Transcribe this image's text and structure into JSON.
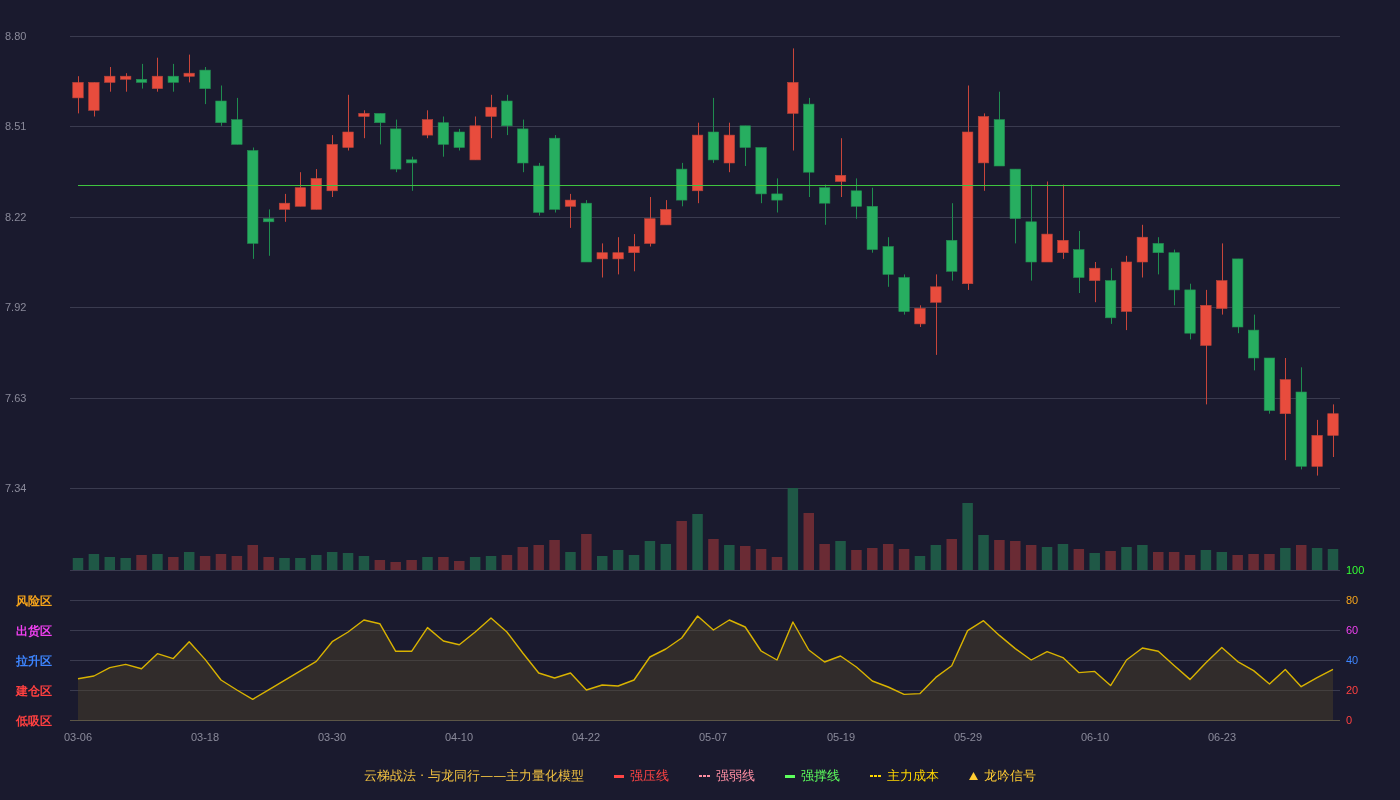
{
  "price_chart": {
    "chart_data": {
      "type": "candlestick",
      "grid": true,
      "categories": [
        null,
        null,
        null,
        null,
        null,
        null,
        null,
        null,
        null,
        null,
        null,
        null,
        null,
        null,
        null,
        null,
        null,
        null,
        null,
        null,
        null,
        null,
        null,
        null,
        null,
        null,
        null,
        null,
        null,
        null,
        null,
        null,
        null,
        null,
        null,
        null,
        null,
        null,
        null,
        null,
        null,
        null,
        null,
        null,
        null,
        null,
        null,
        null,
        null,
        null,
        null,
        null,
        null,
        null,
        null,
        null,
        null,
        null,
        null,
        null,
        null,
        null,
        null,
        null,
        null,
        null,
        null,
        null,
        null,
        null,
        null,
        null,
        null,
        null,
        null,
        null,
        null,
        null,
        null,
        null
      ],
      "ohlc": [
        [
          8.6,
          8.67,
          8.55,
          8.65
        ],
        [
          8.56,
          8.65,
          8.54,
          8.65
        ],
        [
          8.65,
          8.7,
          8.62,
          8.67
        ],
        [
          8.66,
          8.68,
          8.62,
          8.67
        ],
        [
          8.66,
          8.71,
          8.63,
          8.65
        ],
        [
          8.63,
          8.73,
          8.62,
          8.67
        ],
        [
          8.67,
          8.71,
          8.62,
          8.65
        ],
        [
          8.67,
          8.74,
          8.65,
          8.68
        ],
        [
          8.69,
          8.7,
          8.58,
          8.63
        ],
        [
          8.59,
          8.64,
          8.51,
          8.52
        ],
        [
          8.53,
          8.6,
          8.45,
          8.45
        ],
        [
          8.43,
          8.44,
          8.08,
          8.13
        ],
        [
          8.21,
          8.24,
          8.09,
          8.2
        ],
        [
          8.24,
          8.29,
          8.2,
          8.26
        ],
        [
          8.25,
          8.36,
          8.25,
          8.31
        ],
        [
          8.24,
          8.37,
          8.24,
          8.34
        ],
        [
          8.3,
          8.48,
          8.28,
          8.45
        ],
        [
          8.44,
          8.61,
          8.43,
          8.49
        ],
        [
          8.54,
          8.56,
          8.47,
          8.55
        ],
        [
          8.55,
          8.55,
          8.45,
          8.52
        ],
        [
          8.5,
          8.53,
          8.36,
          8.37
        ],
        [
          8.4,
          8.41,
          8.3,
          8.39
        ],
        [
          8.48,
          8.56,
          8.47,
          8.53
        ],
        [
          8.52,
          8.54,
          8.41,
          8.45
        ],
        [
          8.49,
          8.5,
          8.43,
          8.44
        ],
        [
          8.4,
          8.54,
          8.4,
          8.51
        ],
        [
          8.54,
          8.61,
          8.47,
          8.57
        ],
        [
          8.59,
          8.61,
          8.48,
          8.51
        ],
        [
          8.5,
          8.53,
          8.36,
          8.39
        ],
        [
          8.38,
          8.39,
          8.22,
          8.23
        ],
        [
          8.47,
          8.48,
          8.23,
          8.24
        ],
        [
          8.25,
          8.29,
          8.18,
          8.27
        ],
        [
          8.26,
          8.27,
          8.07,
          8.07
        ],
        [
          8.08,
          8.13,
          8.02,
          8.1
        ],
        [
          8.08,
          8.15,
          8.03,
          8.1
        ],
        [
          8.1,
          8.16,
          8.04,
          8.12
        ],
        [
          8.13,
          8.28,
          8.12,
          8.21
        ],
        [
          8.19,
          8.27,
          8.19,
          8.24
        ],
        [
          8.37,
          8.39,
          8.25,
          8.27
        ],
        [
          8.3,
          8.52,
          8.26,
          8.48
        ],
        [
          8.49,
          8.6,
          8.39,
          8.4
        ],
        [
          8.39,
          8.52,
          8.36,
          8.48
        ],
        [
          8.51,
          8.51,
          8.38,
          8.44
        ],
        [
          8.44,
          8.44,
          8.26,
          8.29
        ],
        [
          8.29,
          8.34,
          8.23,
          8.27
        ],
        [
          8.55,
          8.76,
          8.43,
          8.65
        ],
        [
          8.58,
          8.6,
          8.28,
          8.36
        ],
        [
          8.31,
          8.32,
          8.19,
          8.26
        ],
        [
          8.33,
          8.47,
          8.28,
          8.35
        ],
        [
          8.3,
          8.34,
          8.21,
          8.25
        ],
        [
          8.25,
          8.31,
          8.1,
          8.11
        ],
        [
          8.12,
          8.15,
          7.99,
          8.03
        ],
        [
          8.02,
          8.03,
          7.9,
          7.91
        ],
        [
          7.87,
          7.93,
          7.86,
          7.92
        ],
        [
          7.94,
          8.03,
          7.77,
          7.99
        ],
        [
          8.14,
          8.26,
          8.01,
          8.04
        ],
        [
          8.0,
          8.64,
          7.98,
          8.49
        ],
        [
          8.39,
          8.55,
          8.3,
          8.54
        ],
        [
          8.53,
          8.62,
          8.38,
          8.38
        ],
        [
          8.37,
          8.37,
          8.13,
          8.21
        ],
        [
          8.2,
          8.32,
          8.01,
          8.07
        ],
        [
          8.07,
          8.33,
          8.07,
          8.16
        ],
        [
          8.1,
          8.32,
          8.08,
          8.14
        ],
        [
          8.11,
          8.17,
          7.97,
          8.02
        ],
        [
          8.01,
          8.07,
          7.94,
          8.05
        ],
        [
          8.01,
          8.05,
          7.87,
          7.89
        ],
        [
          7.91,
          8.09,
          7.85,
          8.07
        ],
        [
          8.07,
          8.19,
          8.02,
          8.15
        ],
        [
          8.13,
          8.15,
          8.03,
          8.1
        ],
        [
          8.1,
          8.11,
          7.93,
          7.98
        ],
        [
          7.98,
          8.0,
          7.82,
          7.84
        ],
        [
          7.8,
          7.98,
          7.61,
          7.93
        ],
        [
          7.92,
          8.13,
          7.9,
          8.01
        ],
        [
          8.08,
          8.08,
          7.84,
          7.86
        ],
        [
          7.85,
          7.9,
          7.72,
          7.76
        ],
        [
          7.76,
          7.76,
          7.58,
          7.59
        ],
        [
          7.58,
          7.76,
          7.43,
          7.69
        ],
        [
          7.65,
          7.73,
          7.4,
          7.41
        ],
        [
          7.41,
          7.56,
          7.38,
          7.51
        ],
        [
          7.51,
          7.61,
          7.44,
          7.58
        ]
      ],
      "ylim": [
        7.34,
        8.8
      ],
      "yticks": [
        {
          "value": 8.8,
          "label": "8.80"
        },
        {
          "value": 8.508,
          "label": "8.51"
        },
        {
          "value": 8.216,
          "label": "8.22"
        },
        {
          "value": 7.924,
          "label": "7.92"
        },
        {
          "value": 7.632,
          "label": "7.63"
        },
        {
          "value": 7.34,
          "label": "7.34"
        }
      ],
      "ref_lines": [
        {
          "axis": "y",
          "value": 8.32
        }
      ]
    }
  },
  "indicator": {
    "zones": [
      {
        "label": "风险区",
        "color": "#f5a31a"
      },
      {
        "label": "出货区",
        "color": "#f040f0"
      },
      {
        "label": "拉升区",
        "color": "#3d85ff"
      },
      {
        "label": "建仓区",
        "color": "#ff4040"
      },
      {
        "label": "低吸区",
        "color": "#ff4040"
      }
    ],
    "chart_data": {
      "type": "area",
      "grid": true,
      "categories": [
        "03-06",
        null,
        null,
        null,
        null,
        null,
        null,
        null,
        "03-18",
        null,
        null,
        null,
        null,
        null,
        null,
        null,
        "03-30",
        null,
        null,
        null,
        null,
        null,
        null,
        null,
        "04-10",
        null,
        null,
        null,
        null,
        null,
        null,
        null,
        "04-22",
        null,
        null,
        null,
        null,
        null,
        null,
        null,
        "05-07",
        null,
        null,
        null,
        null,
        null,
        null,
        null,
        "05-19",
        null,
        null,
        null,
        null,
        null,
        null,
        null,
        "05-29",
        null,
        null,
        null,
        null,
        null,
        null,
        null,
        "06-10",
        null,
        null,
        null,
        null,
        null,
        null,
        null,
        "06-23",
        null,
        null,
        null,
        null,
        null,
        null,
        null
      ],
      "values": [
        27.5,
        29.3,
        34.9,
        37.1,
        34.2,
        44.2,
        40.9,
        52.2,
        40.4,
        26.7,
        20.0,
        13.8,
        20.1,
        26.4,
        32.8,
        39.1,
        52.2,
        58.7,
        66.7,
        64.2,
        45.8,
        45.8,
        61.6,
        52.7,
        50.2,
        58.7,
        68.0,
        58.7,
        44.7,
        31.3,
        28.0,
        31.3,
        20.0,
        23.3,
        22.7,
        26.7,
        42.0,
        47.3,
        54.7,
        69.3,
        60.0,
        66.7,
        62.0,
        46.0,
        40.0,
        65.3,
        46.7,
        38.7,
        42.7,
        35.3,
        26.0,
        22.0,
        17.1,
        17.6,
        28.4,
        36.2,
        59.6,
        66.2,
        56.4,
        47.6,
        40.0,
        45.6,
        41.6,
        31.6,
        32.4,
        22.9,
        40.0,
        48.0,
        45.8,
        36.4,
        27.1,
        38.2,
        48.4,
        38.9,
        32.9,
        24.0,
        33.6,
        22.2,
        28.2,
        33.8
      ],
      "ylim": [
        0,
        100
      ],
      "yticks": [
        100,
        80,
        60,
        40,
        20,
        0
      ]
    }
  },
  "legend": {
    "title": "云梯战法 · 与龙同行——主力量化模型",
    "items": [
      {
        "kind": "solid",
        "label": "强压线",
        "color": "#ff4444"
      },
      {
        "kind": "dashed",
        "label": "强弱线",
        "color": "#ff8fa3"
      },
      {
        "kind": "solid",
        "label": "强撑线",
        "color": "#5dff5d"
      },
      {
        "kind": "dashed",
        "label": "主力成本",
        "color": "#ffd700"
      },
      {
        "kind": "triangle",
        "label": "龙吟信号",
        "color": "#ffcc33"
      }
    ]
  }
}
